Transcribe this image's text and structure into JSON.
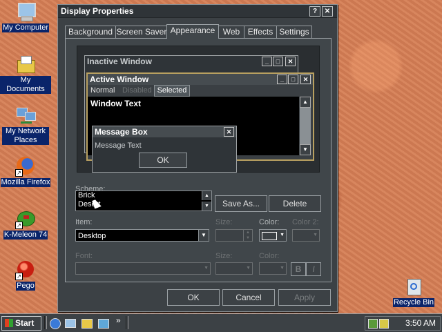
{
  "desktop": {
    "icons": [
      {
        "label": "My Computer",
        "icon": "computer-icon"
      },
      {
        "label": "My Documents",
        "icon": "folder-icon"
      },
      {
        "label": "My Network Places",
        "icon": "network-icon"
      },
      {
        "label": "Mozilla Firefox",
        "icon": "firefox-icon"
      },
      {
        "label": "K-Meleon 74",
        "icon": "kmeleon-icon"
      },
      {
        "label": "Pego",
        "icon": "pego-icon"
      },
      {
        "label": "Recycle Bin",
        "icon": "recycle-bin-icon"
      }
    ]
  },
  "dialog": {
    "title": "Display Properties",
    "help_glyph": "?",
    "close_glyph": "✕",
    "tabs": [
      "Background",
      "Screen Saver",
      "Appearance",
      "Web",
      "Effects",
      "Settings"
    ],
    "active_tab": "Appearance",
    "preview": {
      "inactive_title": "Inactive Window",
      "active_title": "Active Window",
      "menu": [
        "Normal",
        "Disabled",
        "Selected"
      ],
      "window_text": "Window Text",
      "msgbox_title": "Message Box",
      "msgbox_text": "Message Text",
      "msgbox_ok": "OK"
    },
    "scheme": {
      "label": "Scheme:",
      "options": [
        "Brick",
        "Desert"
      ],
      "save_as": "Save As...",
      "delete": "Delete"
    },
    "item": {
      "label": "Item:",
      "value": "Desktop",
      "size_label": "Size:",
      "color_label": "Color:",
      "color2_label": "Color 2:",
      "color_value": "#3c4145"
    },
    "font": {
      "label": "Font:",
      "size_label": "Size:",
      "color_label": "Color:",
      "bold": "B",
      "italic": "I"
    },
    "buttons": {
      "ok": "OK",
      "cancel": "Cancel",
      "apply": "Apply"
    }
  },
  "taskbar": {
    "start_label": "Start",
    "chevron": "»",
    "clock": "3:50 AM"
  }
}
